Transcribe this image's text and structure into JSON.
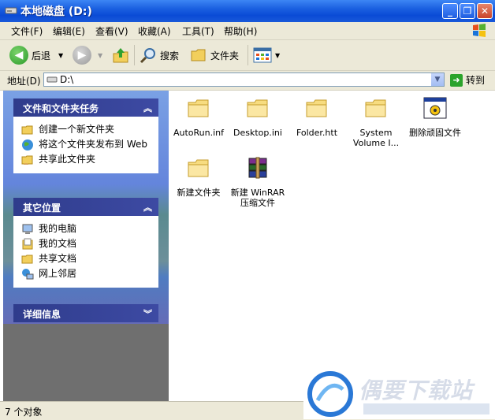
{
  "window": {
    "title": "本地磁盘 (D:)"
  },
  "menu": [
    "文件(F)",
    "编辑(E)",
    "查看(V)",
    "收藏(A)",
    "工具(T)",
    "帮助(H)"
  ],
  "toolbar": {
    "back": "后退",
    "search": "搜索",
    "folders": "文件夹"
  },
  "address": {
    "label": "地址(D)",
    "value": "D:\\",
    "go": "转到"
  },
  "tasks_panel": {
    "title": "文件和文件夹任务",
    "items": [
      "创建一个新文件夹",
      "将这个文件夹发布到 Web",
      "共享此文件夹"
    ]
  },
  "places_panel": {
    "title": "其它位置",
    "items": [
      "我的电脑",
      "我的文档",
      "共享文档",
      "网上邻居"
    ]
  },
  "details_panel": {
    "title": "详细信息"
  },
  "files": [
    {
      "name": "AutoRun.inf",
      "icon": "folder-icon"
    },
    {
      "name": "Desktop.ini",
      "icon": "folder-icon"
    },
    {
      "name": "Folder.htt",
      "icon": "folder-icon"
    },
    {
      "name": "System Volume I...",
      "icon": "folder-icon"
    },
    {
      "name": "删除顽固文件",
      "icon": "gear-window-icon"
    },
    {
      "name": "新建文件夹",
      "icon": "folder-icon"
    },
    {
      "name": "新建 WinRAR 压缩文件",
      "icon": "winrar-icon"
    }
  ],
  "status": {
    "text": "7 个对象"
  },
  "watermark": {
    "text": "偶要下载站"
  },
  "colors": {
    "titlebar": "#0a4bd6",
    "panel_head": "#2f3c8c",
    "chrome": "#ece9d8"
  }
}
